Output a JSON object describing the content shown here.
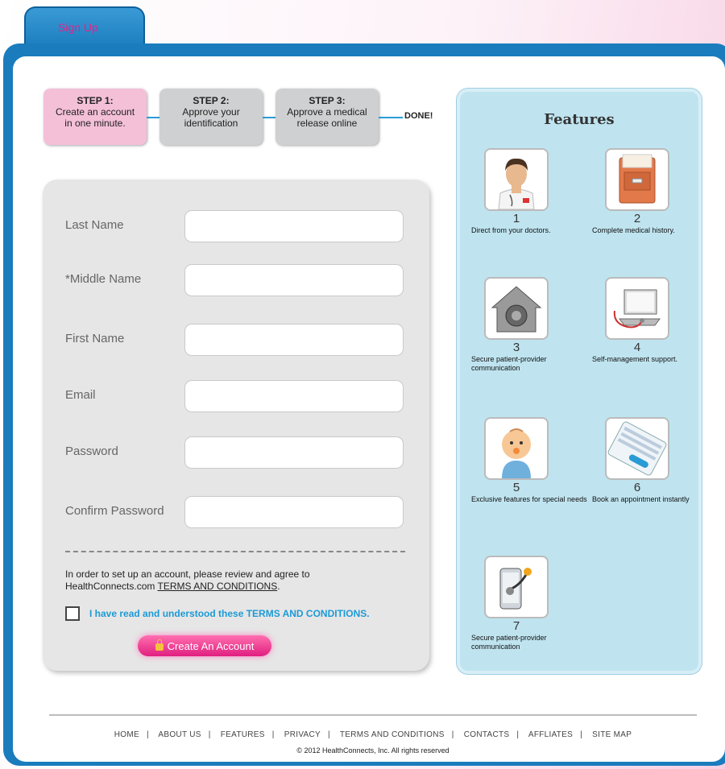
{
  "tab": {
    "label": "Sign Up"
  },
  "steps": [
    {
      "num": "STEP 1",
      "line1": "Create an account",
      "line2": "in one minute."
    },
    {
      "num": "STEP 2",
      "line1": "Approve your",
      "line2": "identification"
    },
    {
      "num": "STEP 3",
      "line1": "Approve a medical",
      "line2": "release online"
    }
  ],
  "done_label": "DONE!",
  "form": {
    "fields": [
      {
        "label": "Last Name",
        "value": ""
      },
      {
        "label": "*Middle Name",
        "value": ""
      },
      {
        "label": "First Name",
        "value": ""
      },
      {
        "label": "Email",
        "value": ""
      },
      {
        "label": "Password",
        "value": ""
      },
      {
        "label": "Confirm Password",
        "value": ""
      }
    ],
    "terms_line1": "In order to set up an account, please review and agree to",
    "terms_line2_prefix": "HealthConnects.com ",
    "terms_link": "TERMS AND CONDITIONS",
    "terms_suffix": ".",
    "checkbox_label": "I have read and understood these TERMS AND CONDITIONS.",
    "create_button": "Create An Account"
  },
  "features": {
    "title": "Features",
    "items": [
      {
        "num": "1",
        "desc": "Direct from your doctors.",
        "icon": "doctor-icon"
      },
      {
        "num": "2",
        "desc": "Complete medical history.",
        "icon": "file-cabinet-icon"
      },
      {
        "num": "3",
        "desc": "Secure patient-provider communication",
        "icon": "vault-house-icon"
      },
      {
        "num": "4",
        "desc": "Self-management support.",
        "icon": "laptop-stethoscope-icon"
      },
      {
        "num": "5",
        "desc": "Exclusive features for special needs",
        "icon": "baby-icon"
      },
      {
        "num": "6",
        "desc": "Book an appointment instantly",
        "icon": "booking-screen-icon"
      },
      {
        "num": "7",
        "desc": "Secure patient-provider communication",
        "icon": "phone-stethoscope-icon"
      }
    ]
  },
  "footer": {
    "links": [
      "HOME",
      "ABOUT US",
      "FEATURES",
      "PRIVACY",
      "TERMS AND CONDITIONS",
      "CONTACTS",
      "AFFLIATES",
      "SITE MAP"
    ],
    "copyright": "2012 HealthConnects, Inc.  All rights reserved"
  }
}
